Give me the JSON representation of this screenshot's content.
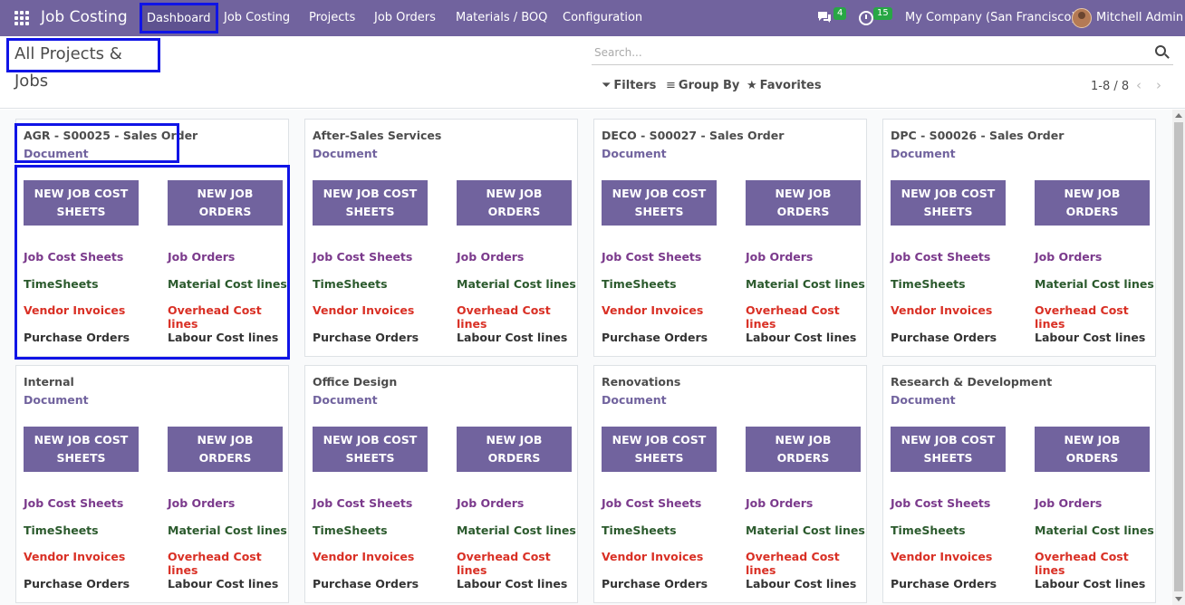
{
  "navbar": {
    "brand": "Job Costing",
    "menu": [
      "Dashboard",
      "Job Costing",
      "Projects",
      "Job Orders",
      "Materials / BOQ",
      "Configuration"
    ],
    "messages_count": "4",
    "activities_count": "15",
    "company": "My Company (San Francisco)",
    "user": "Mitchell Admin",
    "accent_color": "#71639e"
  },
  "control": {
    "title": "All Projects & Jobs",
    "search_placeholder": "Search...",
    "filters": "Filters",
    "group_by": "Group By",
    "favorites": "Favorites",
    "pager": "1-8 / 8"
  },
  "card_labels": {
    "document": "Document",
    "btn_cost_sheets": "NEW JOB COST SHEETS",
    "btn_job_orders": "NEW JOB ORDERS",
    "job_cost_sheets": "Job Cost Sheets",
    "job_orders": "Job Orders",
    "timesheets": "TimeSheets",
    "material_cost_lines": "Material Cost lines",
    "vendor_invoices": "Vendor Invoices",
    "overhead_cost_lines": "Overhead Cost lines",
    "purchase_orders": "Purchase Orders",
    "labour_cost_lines": "Labour Cost lines"
  },
  "projects": [
    {
      "title": "AGR - S00025 - Sales Order"
    },
    {
      "title": "After-Sales Services"
    },
    {
      "title": "DECO - S00027 - Sales Order"
    },
    {
      "title": "DPC - S00026 - Sales Order"
    },
    {
      "title": "Internal"
    },
    {
      "title": "Office Design"
    },
    {
      "title": "Renovations"
    },
    {
      "title": "Research & Development"
    }
  ]
}
